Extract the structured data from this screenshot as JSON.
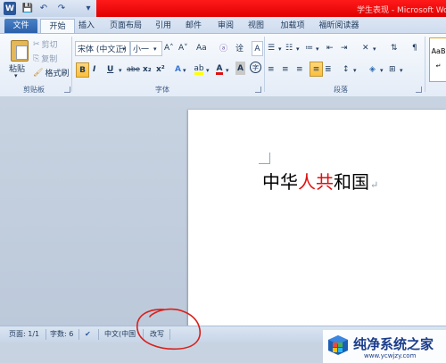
{
  "app": {
    "title": "学生表现 - Microsoft Wo",
    "logo_letter": "W"
  },
  "quick_access": [
    {
      "name": "save-icon",
      "glyph": "💾"
    },
    {
      "name": "undo-icon",
      "glyph": "↶"
    },
    {
      "name": "redo-icon",
      "glyph": "↷"
    },
    {
      "name": "customize-icon",
      "glyph": "▾"
    }
  ],
  "tabs": [
    "文件",
    "开始",
    "插入",
    "页面布局",
    "引用",
    "邮件",
    "审阅",
    "视图",
    "加载项",
    "福昕阅读器"
  ],
  "ribbon": {
    "clipboard": {
      "label": "剪贴板",
      "paste": "粘贴",
      "cut": "剪切",
      "copy": "复制",
      "format_painter": "格式刷"
    },
    "font": {
      "label": "字体",
      "font_name": "宋体 (中文正)",
      "font_size": "小一",
      "grow": "A˄",
      "shrink": "A˅",
      "change_case": "Aa",
      "clear_format": "ⓐ",
      "phonetic": "诠",
      "char_border": "A",
      "bold": "B",
      "italic": "I",
      "underline": "U",
      "strikethrough": "abe",
      "subscript": "x₂",
      "superscript": "x²",
      "text_effect": "A",
      "highlight": "ab",
      "font_color": "A",
      "char_shading": "A",
      "enclose": "字",
      "highlight_color": "#ffff00",
      "font_color_value": "#e01010"
    },
    "paragraph": {
      "label": "段落"
    },
    "styles": {
      "preview": "AaB"
    }
  },
  "document": {
    "text_before": "中华",
    "text_red": "人共",
    "text_after": "和国",
    "paragraph_mark": "↵",
    "red_color": "#e01010"
  },
  "statusbar": {
    "page": "页面: 1/1",
    "words": "字数: 6",
    "language": "中文(中国",
    "mode": "改写"
  },
  "watermark": {
    "title": "纯净系统之家",
    "url": "www.ycwjzy.com"
  }
}
